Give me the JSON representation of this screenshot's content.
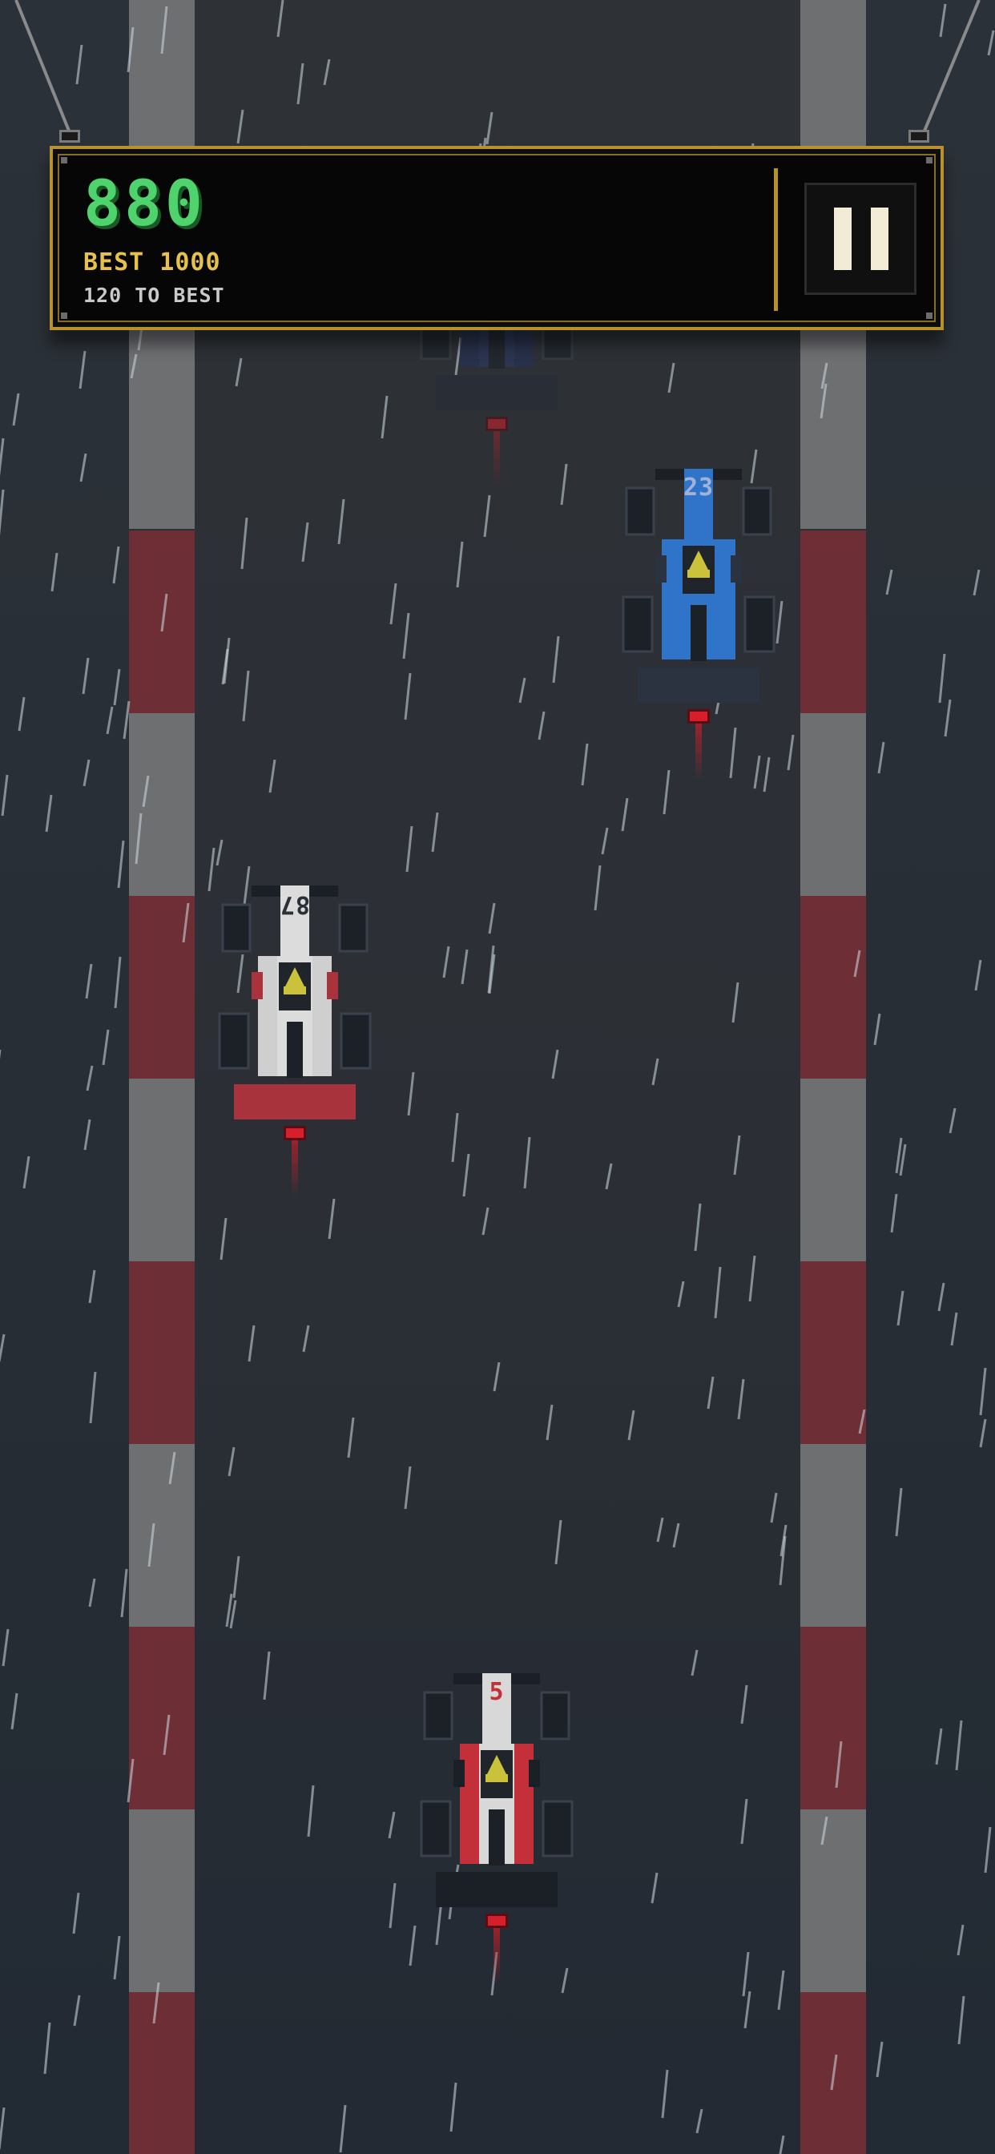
{
  "hud": {
    "score": "880",
    "best": "BEST 1000",
    "to_best": "120 TO BEST"
  },
  "cars": {
    "rival_1": {
      "number": "23",
      "color": "blue"
    },
    "rival_2": {
      "number": "87",
      "color": "white"
    },
    "player": {
      "number": "5",
      "color": "red"
    },
    "rival_ghost": {
      "number": "",
      "color": "blue"
    }
  },
  "colors": {
    "accent": "#b7922c",
    "score": "#4fd36c",
    "best": "#e6c14c",
    "curb_red": "#6e2e36",
    "curb_gray": "#6e6f70"
  },
  "icons": {
    "pause": "pause-icon"
  }
}
